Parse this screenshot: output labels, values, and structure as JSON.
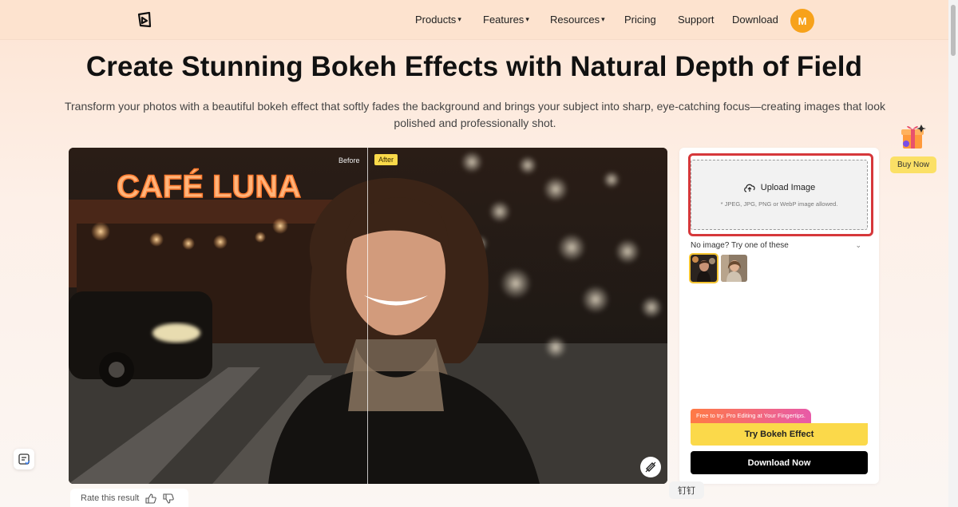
{
  "nav": {
    "items": [
      {
        "label": "Products",
        "dropdown": true
      },
      {
        "label": "Features",
        "dropdown": true
      },
      {
        "label": "Resources",
        "dropdown": true
      },
      {
        "label": "Pricing",
        "dropdown": false
      },
      {
        "label": "Support",
        "dropdown": false
      },
      {
        "label": "Download",
        "dropdown": false
      }
    ],
    "caret_glyph": "▾",
    "avatar_initial": "M"
  },
  "hero": {
    "title": "Create Stunning Bokeh Effects with Natural Depth of Field",
    "subtitle": "Transform your photos with a beautiful bokeh effect that softly fades the background and brings your subject into sharp, eye-catching focus—creating images that look polished and professionally shot."
  },
  "preview": {
    "before_label": "Before",
    "after_label": "After",
    "sign_text": "CAFÉ LUNA",
    "compare_icon": "compare-icon"
  },
  "upload": {
    "title": "Upload Image",
    "hint": "* JPEG, JPG, PNG or WebP image allowed.",
    "icon": "cloud-upload-icon"
  },
  "samples": {
    "heading": "No image? Try one of these",
    "count_selected": 1
  },
  "actions": {
    "promo_tag": "Free to try. Pro Editing at Your Fingertips.",
    "try_label": "Try Bokeh Effect",
    "download_label": "Download Now"
  },
  "side": {
    "buy_now_label": "Buy Now"
  },
  "rating": {
    "label": "Rate this result"
  },
  "floating": {
    "ding_label": "钉钉"
  },
  "colors": {
    "accent_yellow": "#fbd94a",
    "highlight_red": "#d6383b",
    "avatar_orange": "#f7a21b"
  }
}
